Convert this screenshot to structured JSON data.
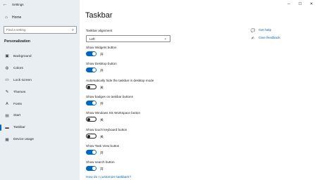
{
  "window": {
    "title": "Settings",
    "controls": {
      "minimize": "─",
      "maximize": "☐",
      "close": "✕"
    }
  },
  "sidebar": {
    "home": {
      "label": "Home",
      "icon": "home-icon"
    },
    "search": {
      "placeholder": "Find a setting",
      "icon": "search-icon"
    },
    "section_title": "Personalization",
    "items": [
      {
        "label": "Background",
        "icon": "image-icon",
        "glyph": "▣",
        "active": false
      },
      {
        "label": "Colors",
        "icon": "palette-icon",
        "glyph": "◍",
        "active": false
      },
      {
        "label": "Lock screen",
        "icon": "lock-screen-icon",
        "glyph": "▭",
        "active": false
      },
      {
        "label": "Themes",
        "icon": "brush-icon",
        "glyph": "✎",
        "active": false
      },
      {
        "label": "Fonts",
        "icon": "font-icon",
        "glyph": "A",
        "active": false
      },
      {
        "label": "Start",
        "icon": "start-icon",
        "glyph": "▤",
        "active": false
      },
      {
        "label": "Taskbar",
        "icon": "taskbar-icon",
        "glyph": "▬",
        "active": true
      },
      {
        "label": "Device usage",
        "icon": "device-usage-icon",
        "glyph": "▦",
        "active": false
      }
    ]
  },
  "main": {
    "title": "Taskbar",
    "alignment": {
      "label": "Taskbar alignment",
      "value": "Left"
    },
    "settings": [
      {
        "label": "Show Widgets button",
        "on": true,
        "state": "开"
      },
      {
        "label": "Show Desktop button",
        "on": true,
        "state": "开"
      },
      {
        "label": "Automatically hide the taskbar in desktop mode",
        "on": false,
        "state": "关"
      },
      {
        "label": "Show badges on taskbar buttons",
        "on": true,
        "state": "开"
      },
      {
        "label": "Show Windows Ink Workspace button",
        "on": false,
        "state": "关"
      },
      {
        "label": "Show touch keyboard button",
        "on": false,
        "state": "关"
      },
      {
        "label": "Show Task View button",
        "on": true,
        "state": "开"
      },
      {
        "label": "Show search button",
        "on": true,
        "state": "开"
      }
    ],
    "customize_link": "How do I customize taskbars?"
  },
  "help": {
    "get_help": "Get help",
    "give_feedback": "Give feedback"
  },
  "colors": {
    "accent": "#0067c0",
    "sidebar_bg": "#e9eef3",
    "link": "#0063b1"
  }
}
